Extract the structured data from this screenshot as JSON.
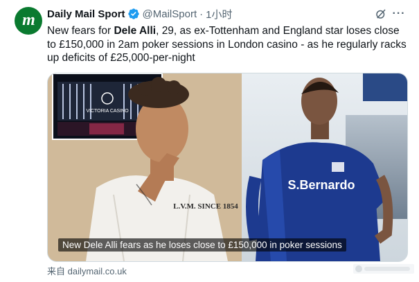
{
  "account": {
    "display_name": "Daily Mail Sport",
    "handle": "@MailSport",
    "separator": "·",
    "time": "1小时",
    "avatar_letters": "m",
    "avatar_color": "#0a7a2f",
    "verified_color": "#1d9bf0"
  },
  "tweet": {
    "text_before": "New fears for ",
    "text_bold": "Dele Alli",
    "text_after": ", 29, as ex-Tottenham and England star loses close to £150,000 in 2am poker sessions in London casino - as he regularly racks up deficits of £25,000-per-night"
  },
  "media": {
    "caption": "New Dele Alli fears as he loses close to £150,000 in poker sessions",
    "inset_sign": "VICTORIA CASINO",
    "shirt_print": "L.V.M. SINCE 1854",
    "jersey_sponsor": "S.Bernardo"
  },
  "footer": {
    "source": "来自 dailymail.co.uk"
  },
  "icons": [
    "verified-badge-icon",
    "grok-icon",
    "more-icon"
  ]
}
